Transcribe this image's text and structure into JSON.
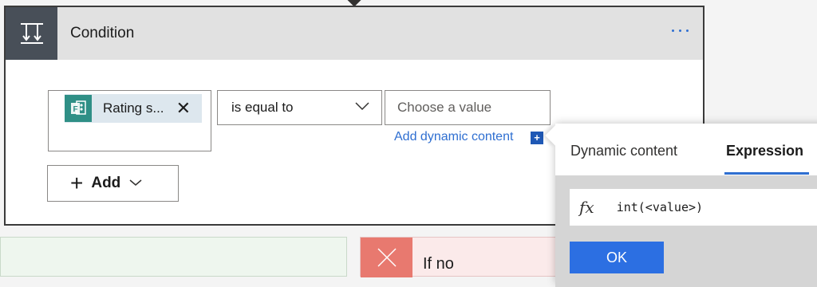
{
  "condition_card": {
    "title": "Condition",
    "icon": "condition-icon",
    "more_icon": "ellipsis-icon"
  },
  "row": {
    "left_token": {
      "label": "Rating s...",
      "icon": "forms-icon",
      "remove_icon": "close-icon"
    },
    "operator": {
      "value": "is equal to",
      "icon": "chevron-down-icon"
    },
    "right_operand": {
      "placeholder": "Choose a value"
    },
    "add_dynamic_content": "Add dynamic content",
    "add_dynamic_icon": "+"
  },
  "add_button": {
    "plus": "+",
    "label": "Add",
    "icon": "chevron-down-icon"
  },
  "branches": {
    "no": {
      "label": "If no",
      "icon": "close-icon",
      "color": "#e8796f"
    }
  },
  "panel": {
    "tabs": [
      {
        "label": "Dynamic content",
        "active": false
      },
      {
        "label": "Expression",
        "active": true
      }
    ],
    "fx": "fx",
    "expression": "int(<value>)",
    "ok_label": "OK"
  },
  "colors": {
    "accent": "#2f6fd1",
    "header_bg": "#e1e1e1",
    "icon_box": "#484f58",
    "ok_button": "#2c6fe2"
  }
}
